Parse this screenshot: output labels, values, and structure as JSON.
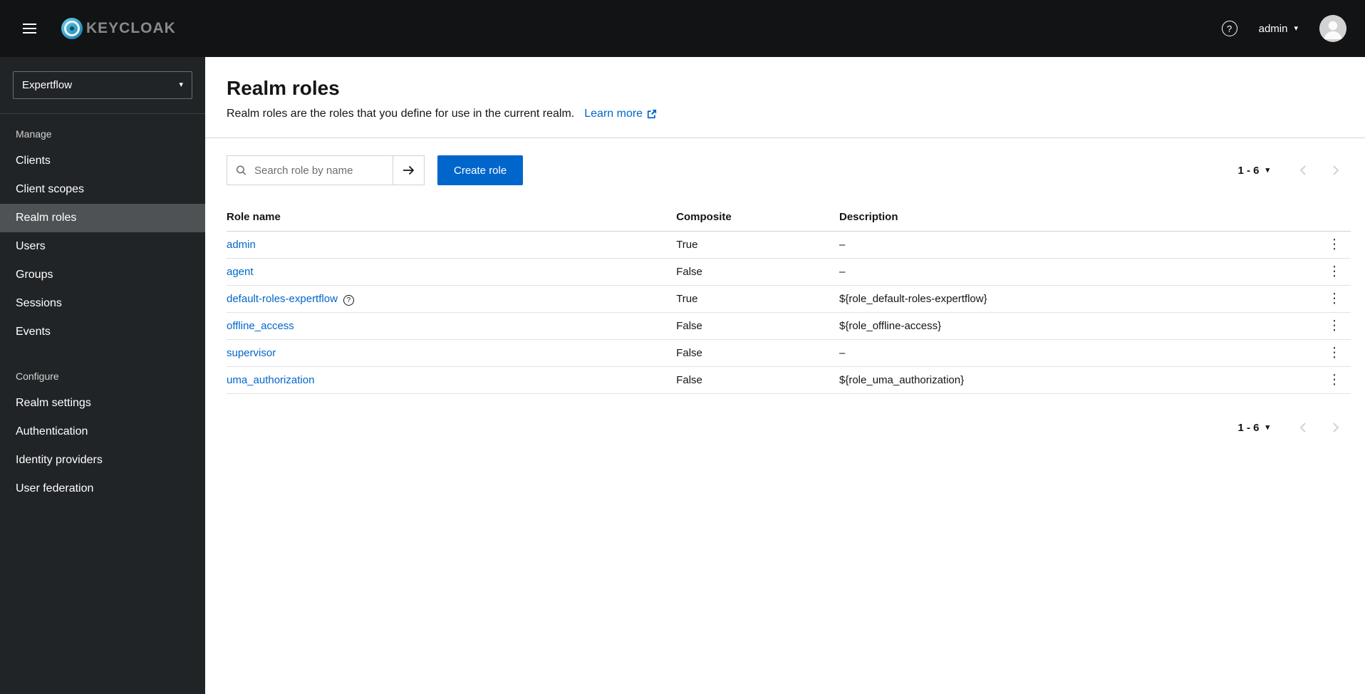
{
  "icons": {
    "caret_down": "▾",
    "kebab": "⋮",
    "help": "?"
  },
  "header": {
    "brand": "KEYCLOAK",
    "user": "admin"
  },
  "sidebar": {
    "realm": "Expertflow",
    "sections": [
      {
        "label": "Manage",
        "items": [
          {
            "label": "Clients"
          },
          {
            "label": "Client scopes"
          },
          {
            "label": "Realm roles"
          },
          {
            "label": "Users"
          },
          {
            "label": "Groups"
          },
          {
            "label": "Sessions"
          },
          {
            "label": "Events"
          }
        ]
      },
      {
        "label": "Configure",
        "items": [
          {
            "label": "Realm settings"
          },
          {
            "label": "Authentication"
          },
          {
            "label": "Identity providers"
          },
          {
            "label": "User federation"
          }
        ]
      }
    ]
  },
  "main": {
    "title": "Realm roles",
    "subtitle": "Realm roles are the roles that you define for use in the current realm.",
    "learn_more": "Learn more",
    "search_placeholder": "Search role by name",
    "create_button": "Create role",
    "pagination_range": "1 - 6",
    "table": {
      "headers": [
        "Role name",
        "Composite",
        "Description"
      ],
      "rows": [
        {
          "name": "admin",
          "composite": "True",
          "description": "–"
        },
        {
          "name": "agent",
          "composite": "False",
          "description": "–"
        },
        {
          "name": "default-roles-expertflow",
          "composite": "True",
          "description": "${role_default-roles-expertflow}"
        },
        {
          "name": "offline_access",
          "composite": "False",
          "description": "${role_offline-access}"
        },
        {
          "name": "supervisor",
          "composite": "False",
          "description": "–"
        },
        {
          "name": "uma_authorization",
          "composite": "False",
          "description": "${role_uma_authorization}"
        }
      ]
    }
  }
}
